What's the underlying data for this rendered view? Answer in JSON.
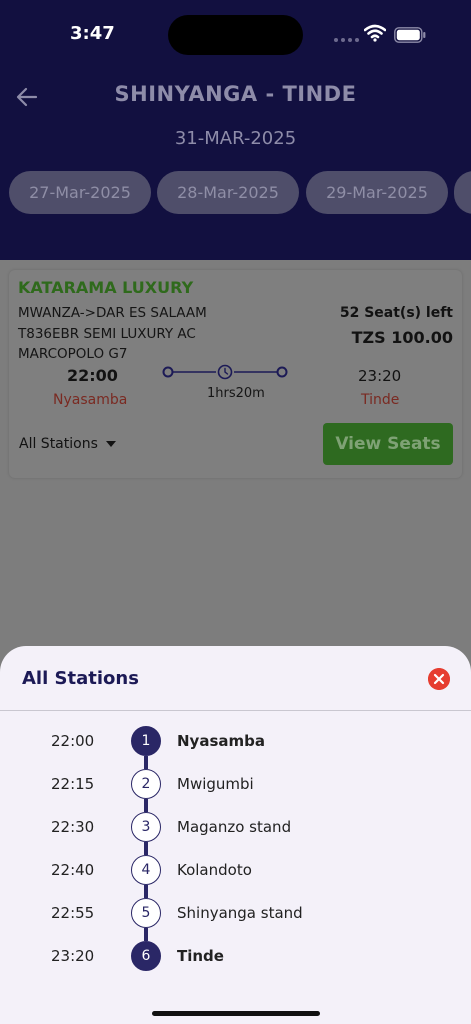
{
  "status_bar": {
    "time": "3:47"
  },
  "header": {
    "route_title": "SHINYANGA - TINDE",
    "selected_date": "31-MAR-2025",
    "date_pills": [
      "27-Mar-2025",
      "28-Mar-2025",
      "29-Mar-2025"
    ]
  },
  "trip": {
    "operator": "KATARAMA LUXURY",
    "route": "MWANZA->DAR ES SALAAM",
    "bus_info": "T836EBR SEMI LUXURY AC",
    "bus_model": "MARCOPOLO G7",
    "seats_left": "52 Seat(s) left",
    "fare": "TZS 100.00",
    "departure_time": "22:00",
    "departure_station": "Nyasamba",
    "arrival_time": "23:20",
    "arrival_station": "Tinde",
    "duration": "1hrs20m",
    "stations_dropdown": "All Stations",
    "view_seats_label": "View Seats"
  },
  "sheet": {
    "title": "All Stations",
    "stops": [
      {
        "time": "22:00",
        "number": "1",
        "name": "Nyasamba"
      },
      {
        "time": "22:15",
        "number": "2",
        "name": "Mwigumbi"
      },
      {
        "time": "22:30",
        "number": "3",
        "name": "Maganzo stand"
      },
      {
        "time": "22:40",
        "number": "4",
        "name": "Kolandoto"
      },
      {
        "time": "22:55",
        "number": "5",
        "name": "Shinyanga stand"
      },
      {
        "time": "23:20",
        "number": "6",
        "name": "Tinde"
      }
    ]
  },
  "colors": {
    "header_bg": "#121040",
    "accent": "#2a2766",
    "operator_green": "#2f6a1c",
    "station_red": "#7a2a22",
    "close_red": "#e63d30"
  },
  "icons": [
    "back-arrow-icon",
    "wifi-icon",
    "battery-icon",
    "clock-icon",
    "chevron-down-icon",
    "close-icon"
  ]
}
